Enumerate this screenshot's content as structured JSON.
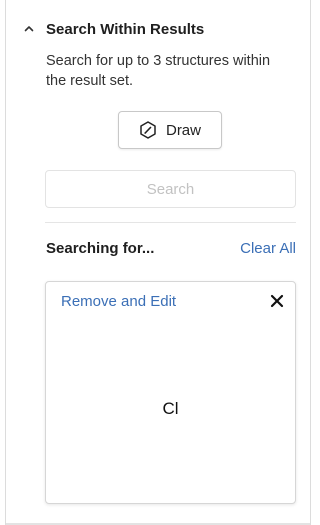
{
  "section": {
    "title": "Search Within Results",
    "description": "Search for up to 3 structures within the result set.",
    "collapse_icon": "chevron-up-icon"
  },
  "draw_button": {
    "label": "Draw",
    "icon": "draw-pen-icon"
  },
  "search_button": {
    "label": "Search",
    "disabled": true
  },
  "searching": {
    "label": "Searching for...",
    "clear_all": "Clear All"
  },
  "structure_card": {
    "remove_edit": "Remove and Edit",
    "close_icon": "close-icon",
    "structure_text": "Cl"
  },
  "colors": {
    "link": "#3b6fb6",
    "disabled_text": "#c2c2c2",
    "border": "#d6d6d6"
  }
}
